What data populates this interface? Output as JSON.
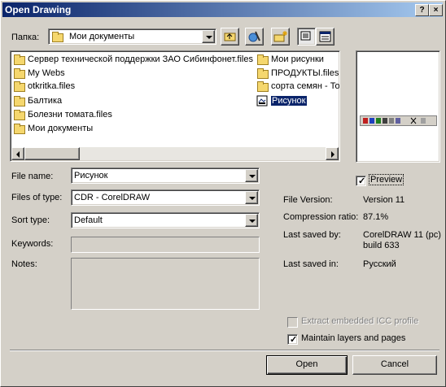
{
  "window": {
    "title": "Open Drawing",
    "help_glyph": "?",
    "close_glyph": "×"
  },
  "lookin": {
    "label": "Папка:",
    "value": "Мои документы"
  },
  "files": [
    {
      "name": "Сервер технической поддержки ЗАО Сибинфонет.files"
    },
    {
      "name": "My Webs"
    },
    {
      "name": "otkritka.files"
    },
    {
      "name": "Балтика"
    },
    {
      "name": "Болезни томата.files"
    },
    {
      "name": "Мои документы"
    },
    {
      "name": "Мои рисунки"
    },
    {
      "name": "ПРОДУКТЫ.files"
    },
    {
      "name": "сорта семян - То"
    },
    {
      "name": "Рисунок",
      "selected": true
    }
  ],
  "form": {
    "filename_label": "File name:",
    "filename_value": "Рисунок",
    "filetype_label": "Files of type:",
    "filetype_value": "CDR - CorelDRAW",
    "sorttype_label": "Sort type:",
    "sorttype_value": "Default",
    "keywords_label": "Keywords:",
    "notes_label": "Notes:"
  },
  "preview": {
    "label": "Preview",
    "checked": true
  },
  "info": {
    "version_label": "File Version:",
    "version_value": "Version 11",
    "compression_label": "Compression ratio:",
    "compression_value": "87.1%",
    "savedby_label": "Last saved by:",
    "savedby_value_1": "CorelDRAW 11 (pc)",
    "savedby_value_2": "build 633",
    "savedin_label": "Last saved in:",
    "savedin_value": "Русский"
  },
  "options": {
    "extract_icc_label": "Extract embedded ICC profile",
    "extract_icc_checked": false,
    "extract_icc_enabled": false,
    "maintain_layers_label": "Maintain layers and pages",
    "maintain_layers_checked": true
  },
  "buttons": {
    "open": "Open",
    "cancel": "Cancel"
  }
}
